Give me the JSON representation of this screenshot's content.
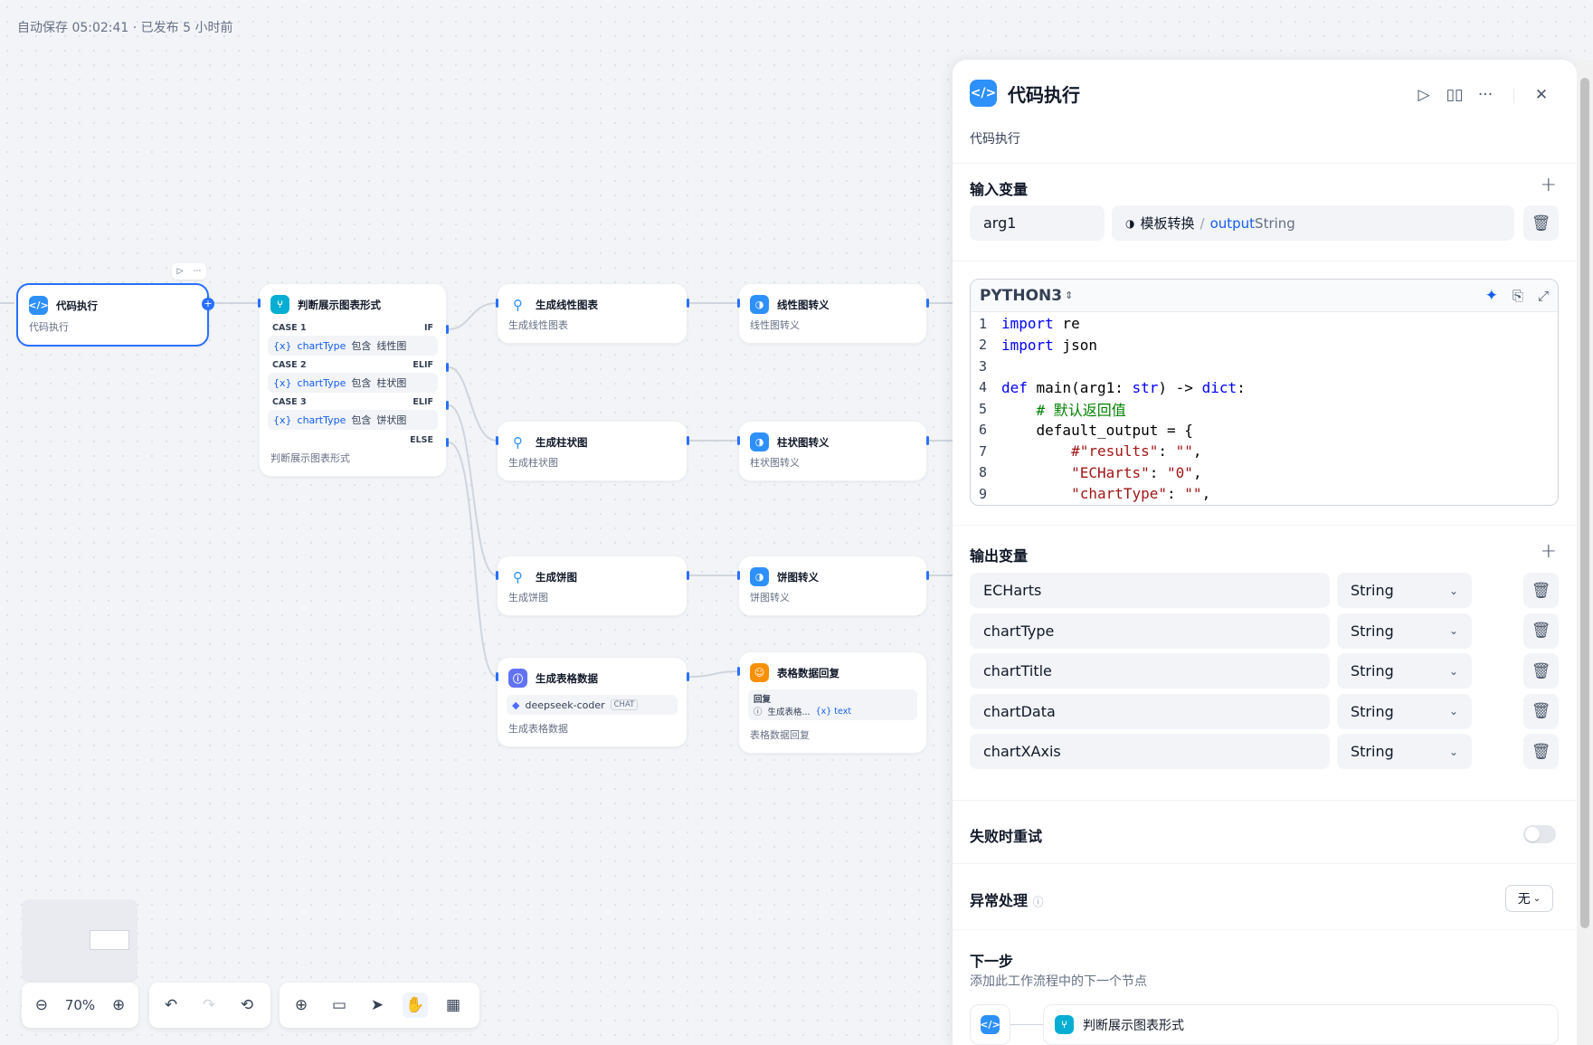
{
  "status": {
    "autosave": "自动保存 05:02:41 · 已发布 5 小时前"
  },
  "nodes": {
    "code": {
      "title": "代码执行",
      "desc": "代码执行"
    },
    "ifelse": {
      "title": "判断展示图表形式",
      "desc": "判断展示图表形式",
      "cases": [
        {
          "case": "CASE 1",
          "kind": "IF",
          "var": "chartType",
          "op": "包含",
          "value": "线性图"
        },
        {
          "case": "CASE 2",
          "kind": "ELIF",
          "var": "chartType",
          "op": "包含",
          "value": "柱状图"
        },
        {
          "case": "CASE 3",
          "kind": "ELIF",
          "var": "chartType",
          "op": "包含",
          "value": "饼状图"
        }
      ],
      "else": "ELSE",
      "var_icon": "{x}"
    },
    "line_gen": {
      "title": "生成线性图表",
      "desc": "生成线性图表"
    },
    "bar_gen": {
      "title": "生成柱状图",
      "desc": "生成柱状图"
    },
    "pie_gen": {
      "title": "生成饼图",
      "desc": "生成饼图"
    },
    "table_gen": {
      "title": "生成表格数据",
      "desc": "生成表格数据",
      "model": "deepseek-coder",
      "model_tag": "CHAT"
    },
    "line_tpl": {
      "title": "线性图转义",
      "desc": "线性图转义"
    },
    "bar_tpl": {
      "title": "柱状图转义",
      "desc": "柱状图转义"
    },
    "pie_tpl": {
      "title": "饼图转义",
      "desc": "饼图转义"
    },
    "table_reply": {
      "title": "表格数据回复",
      "desc": "表格数据回复",
      "reply_label": "回复",
      "ref_node": "生成表格...",
      "ref_var": "{x} text"
    }
  },
  "toolbar": {
    "zoom": "70%"
  },
  "panel": {
    "title": "代码执行",
    "desc": "代码执行",
    "input_section": "输入变量",
    "input": {
      "name": "arg1",
      "source_node": "模板转换",
      "sep": "/",
      "source_var": "output",
      "source_type": "String"
    },
    "code_lang": "PYTHON3",
    "code_lines": [
      {
        "n": "1",
        "html": "<span class='kw'>import</span> re"
      },
      {
        "n": "2",
        "html": "<span class='kw'>import</span> json"
      },
      {
        "n": "3",
        "html": ""
      },
      {
        "n": "4",
        "html": "<span class='kw'>def</span> main(arg1: <span class='kw'>str</span>) -> <span class='kw'>dict</span>:"
      },
      {
        "n": "5",
        "html": "    <span class='cm'># 默认返回值</span>"
      },
      {
        "n": "6",
        "html": "    default_output = {"
      },
      {
        "n": "7",
        "html": "        <span class='str'>#\"results\"</span>: <span class='str'>\"\"</span>,"
      },
      {
        "n": "8",
        "html": "        <span class='str'>\"ECHarts\"</span>: <span class='str'>\"0\"</span>,"
      },
      {
        "n": "9",
        "html": "        <span class='str'>\"chartType\"</span>: <span class='str'>\"\"</span>,"
      }
    ],
    "output_section": "输出变量",
    "outputs": [
      {
        "name": "ECHarts",
        "type": "String"
      },
      {
        "name": "chartType",
        "type": "String"
      },
      {
        "name": "chartTitle",
        "type": "String"
      },
      {
        "name": "chartData",
        "type": "String"
      },
      {
        "name": "chartXAxis",
        "type": "String"
      }
    ],
    "retry_label": "失败时重试",
    "error_label": "异常处理",
    "error_value": "无",
    "next_label": "下一步",
    "next_desc": "添加此工作流程中的下一个节点",
    "next_node": "判断展示图表形式"
  }
}
